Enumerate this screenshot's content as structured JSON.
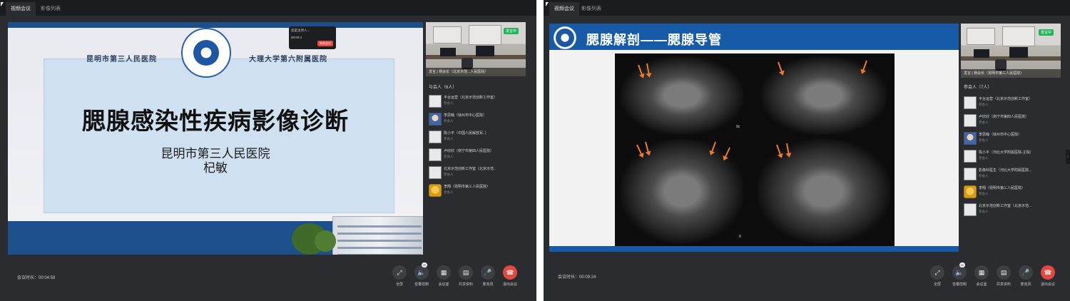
{
  "left": {
    "tabs": [
      "视频会议",
      "影像列表"
    ],
    "slide": {
      "hospital_left": "昆明市第三人民医院",
      "hospital_right": "大理大学第六附属医院",
      "title": "腮腺感染性疾病影像诊断",
      "subtitle": "昆明市第三人民医院",
      "presenter": "杞敏"
    },
    "notification": {
      "line1": "您是主持人...",
      "line2": "00:00:4",
      "button": "结束会议"
    },
    "video_caption": "发言 | 杨会长（北京示范...人民医院）",
    "speaking_badge": "发言中",
    "participants_header": "与会人（6人）",
    "participants": [
      {
        "name": "平台运营（北京示范创新工作室）",
        "role": "参会人",
        "avatar": "blank"
      },
      {
        "name": "李思翰（徐州市中心医院）",
        "role": "参会人",
        "avatar": "face"
      },
      {
        "name": "陈小平（中国人民解放军..）",
        "role": "参会人",
        "avatar": "blank"
      },
      {
        "name": "卢欣欣（南宁市第四人民医院）",
        "role": "参会人",
        "avatar": "blank"
      },
      {
        "name": "北京示范创新工作室（北京示范..",
        "role": "参会人",
        "avatar": "blank"
      },
      {
        "name": "李翔（昆明市第三人民医院）",
        "role": "参会人",
        "avatar": "gold"
      }
    ],
    "timer": "会议时长：00:04:58",
    "controls": [
      {
        "icon": "fullscreen-icon",
        "glyph": "⤢",
        "label": "全屏"
      },
      {
        "icon": "speaker-icon",
        "glyph": "🔈",
        "label": "音量控制",
        "badge": "30"
      },
      {
        "icon": "grid-icon",
        "glyph": "▦",
        "label": "会议室"
      },
      {
        "icon": "document-icon",
        "glyph": "▤",
        "label": "共享资料"
      },
      {
        "icon": "microphone-icon",
        "glyph": "🎤",
        "label": "麦克风"
      },
      {
        "icon": "hangup-icon",
        "glyph": "☎",
        "label": "退出会议"
      }
    ]
  },
  "right": {
    "tabs": [
      "视频会议",
      "影像列表"
    ],
    "slide": {
      "title": "腮腺解剖——腮腺导管"
    },
    "mri_labels": [
      "9c",
      "9"
    ],
    "video_caption": "发言 | 杨会长（昆明市第三人民医院）",
    "speaking_badge": "发言中",
    "participants_header": "参会人（7人）",
    "participants": [
      {
        "name": "平台运营（北京示范创新工作室）",
        "role": "参会人",
        "avatar": "blank"
      },
      {
        "name": "卢欣欣（南宁市第四人民医院）",
        "role": "参会人",
        "avatar": "blank"
      },
      {
        "name": "李思翰（徐州市中心医院）",
        "role": "参会人",
        "avatar": "face"
      },
      {
        "name": "陈小平（河北大学附属医院-主院）",
        "role": "参会人",
        "avatar": "blank"
      },
      {
        "name": "影像科医生（河北大学附属医院...",
        "role": "参会人",
        "avatar": "blank"
      },
      {
        "name": "李翔（昆明市第三人民医院）",
        "role": "参会人",
        "avatar": "gold"
      },
      {
        "name": "北京示范创新工作室（北京示范...",
        "role": "参会人",
        "avatar": "blank"
      }
    ],
    "timer": "会议时长：00:09:24",
    "controls": [
      {
        "icon": "fullscreen-icon",
        "glyph": "⤢",
        "label": "全屏"
      },
      {
        "icon": "speaker-icon",
        "glyph": "🔈",
        "label": "音量控制",
        "badge": "30"
      },
      {
        "icon": "grid-icon",
        "glyph": "▦",
        "label": "会议室"
      },
      {
        "icon": "document-icon",
        "glyph": "▤",
        "label": "共享资料"
      },
      {
        "icon": "microphone-icon",
        "glyph": "🎤",
        "label": "麦克风"
      },
      {
        "icon": "hangup-icon",
        "glyph": "☎",
        "label": "退出会议"
      }
    ],
    "scroll_glyph": "›"
  },
  "colors": {
    "accent_blue": "#175aa8",
    "end_call_red": "#e5483f",
    "speaking_green": "#24b35a",
    "arrow_orange": "#f07a2d"
  }
}
